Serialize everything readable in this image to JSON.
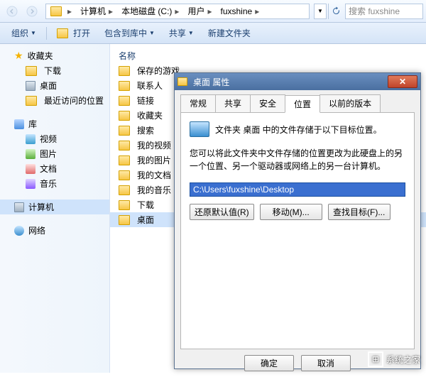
{
  "breadcrumb": [
    "计算机",
    "本地磁盘 (C:)",
    "用户",
    "fuxshine"
  ],
  "search_placeholder": "搜索 fuxshine",
  "toolbar": {
    "organize": "组织",
    "open": "打开",
    "include": "包含到库中",
    "share": "共享",
    "newfolder": "新建文件夹"
  },
  "sidebar": {
    "favorites": "收藏夹",
    "fav_items": [
      "下载",
      "桌面",
      "最近访问的位置"
    ],
    "libraries": "库",
    "lib_items": [
      "视频",
      "图片",
      "文档",
      "音乐"
    ],
    "computer": "计算机",
    "network": "网络"
  },
  "content": {
    "colname": "名称",
    "items": [
      "保存的游戏",
      "联系人",
      "链接",
      "收藏夹",
      "搜索",
      "我的视频",
      "我的图片",
      "我的文档",
      "我的音乐",
      "下载",
      "桌面"
    ]
  },
  "dialog": {
    "title": "桌面 属性",
    "tabs": [
      "常规",
      "共享",
      "安全",
      "位置",
      "以前的版本"
    ],
    "active_tab": 3,
    "info1": "文件夹 桌面 中的文件存储于以下目标位置。",
    "info2": "您可以将此文件夹中文件存储的位置更改为此硬盘上的另一个位置、另一个驱动器或网络上的另一台计算机。",
    "path": "C:\\Users\\fuxshine\\Desktop",
    "btn_restore": "还原默认值(R)",
    "btn_move": "移动(M)...",
    "btn_find": "查找目标(F)...",
    "btn_ok": "确定",
    "btn_cancel": "取消"
  },
  "watermark": "系统之家"
}
